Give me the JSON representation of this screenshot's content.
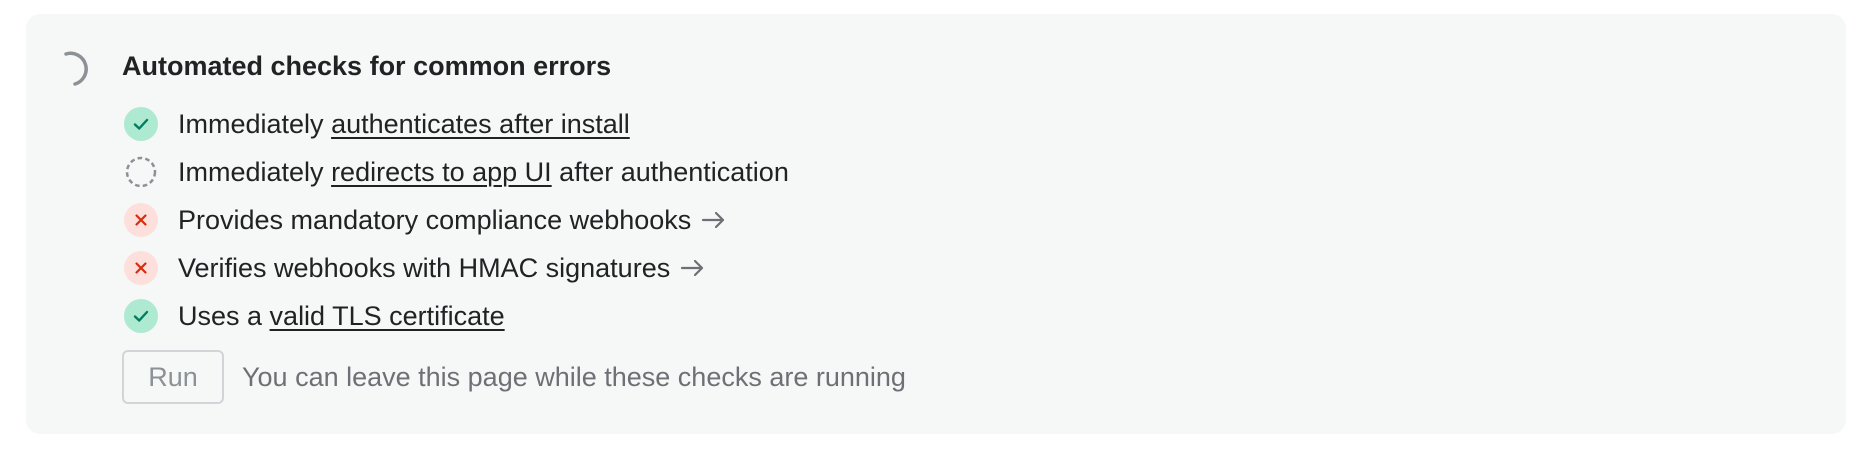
{
  "header": {
    "title": "Automated checks for common errors",
    "status_icon": "spinner-icon"
  },
  "checks": [
    {
      "status": "pass",
      "icon": "checkmark-icon",
      "prefix": "Immediately ",
      "link": "authenticates after install",
      "suffix": ""
    },
    {
      "status": "pending",
      "icon": "dashed-circle-icon",
      "prefix": "Immediately ",
      "link": "redirects to app UI",
      "suffix": " after authentication"
    },
    {
      "status": "fail",
      "icon": "x-icon",
      "text": "Provides mandatory compliance webhooks",
      "arrow": "arrow-right-icon"
    },
    {
      "status": "fail",
      "icon": "x-icon",
      "text": "Verifies webhooks with HMAC signatures",
      "arrow": "arrow-right-icon"
    },
    {
      "status": "pass",
      "icon": "checkmark-icon",
      "prefix": "Uses a ",
      "link": "valid TLS certificate",
      "suffix": ""
    }
  ],
  "run": {
    "button_label": "Run",
    "hint": "You can leave this page while these checks are running"
  },
  "colors": {
    "pass_bg": "#aee9d1",
    "pass_fg": "#007f5f",
    "fail_bg": "#fde0dc",
    "fail_fg": "#d72c0d",
    "pending": "#8c9196",
    "card_bg": "#f6f7f7"
  }
}
